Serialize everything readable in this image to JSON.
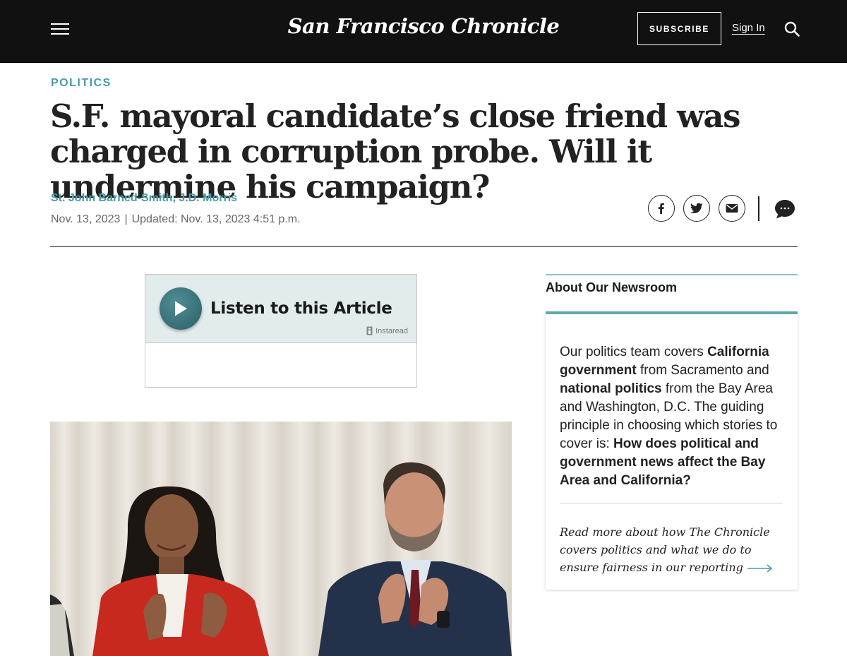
{
  "header": {
    "logo": "San Francisco Chronicle",
    "subscribe_label": "SUBSCRIBE",
    "signin_label": "Sign In"
  },
  "article": {
    "section": "POLITICS",
    "headline": "S.F. mayoral candidate’s close friend was charged in corruption probe. Will it undermine his campaign?",
    "authors": [
      "St. John Barned-Smith",
      "J.D. Morris"
    ],
    "author_separator": ",",
    "published": "Nov. 13, 2023",
    "date_separator": "|",
    "updated": "Updated: Nov. 13, 2023 4:51 p.m."
  },
  "share": {
    "icons": [
      "facebook-icon",
      "twitter-icon",
      "email-icon",
      "comment-icon"
    ]
  },
  "listen": {
    "label": "Listen to this Article",
    "provider": "Instaread"
  },
  "sidebar": {
    "title": "About Our Newsroom",
    "body": [
      {
        "text": "Our politics team covers ",
        "bold": false
      },
      {
        "text": "California government",
        "bold": true
      },
      {
        "text": " from Sacramento and ",
        "bold": false
      },
      {
        "text": "national politics",
        "bold": true
      },
      {
        "text": " from the Bay Area and Washington, D.C. The guiding principle in choosing which stories to cover is: ",
        "bold": false
      },
      {
        "text": "How does political and government news affect the Bay Area and California?",
        "bold": true
      }
    ],
    "link_text": "Read more about how The Chronicle covers politics and what we do to ensure fairness in our reporting"
  },
  "colors": {
    "accent": "#4a9aa6",
    "header_bg": "#111111",
    "card_top": "#5ea7ad"
  }
}
